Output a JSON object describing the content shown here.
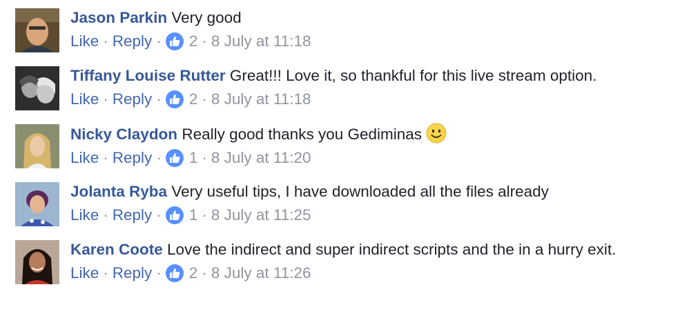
{
  "labels": {
    "like": "Like",
    "reply": "Reply",
    "separator": "·"
  },
  "comments": [
    {
      "author": "Jason Parkin",
      "text": "Very good",
      "likes": "2",
      "timestamp": "8 July at 11:18",
      "avatar_colors": [
        "#6f5a3c",
        "#d9a57a"
      ]
    },
    {
      "author": "Tiffany Louise Rutter",
      "text": "Great!!! Love it, so thankful for this live stream option.",
      "likes": "2",
      "timestamp": "8 July at 11:18",
      "avatar_colors": [
        "#3a3a3a",
        "#bdbdbd"
      ]
    },
    {
      "author": "Nicky Claydon",
      "text": "Really good thanks you Gediminas",
      "emoji": "smiling-face-emoji",
      "likes": "1",
      "timestamp": "8 July at 11:20",
      "avatar_colors": [
        "#c9a864",
        "#e8c7a0"
      ]
    },
    {
      "author": "Jolanta Ryba",
      "text": "Very useful tips, I have downloaded all the files already",
      "likes": "1",
      "timestamp": "8 July at 11:25",
      "avatar_colors": [
        "#7a3a8a",
        "#e0b090"
      ]
    },
    {
      "author": "Karen Coote",
      "text": "Love the indirect and super indirect scripts and the in a hurry exit.",
      "likes": "2",
      "timestamp": "8 July at 11:26",
      "avatar_colors": [
        "#2a1a14",
        "#b07858"
      ]
    }
  ],
  "colors": {
    "author": "#365899",
    "link": "#4267b2",
    "meta": "#90949c",
    "text": "#1d2129",
    "like_badge": "#5890ff"
  }
}
